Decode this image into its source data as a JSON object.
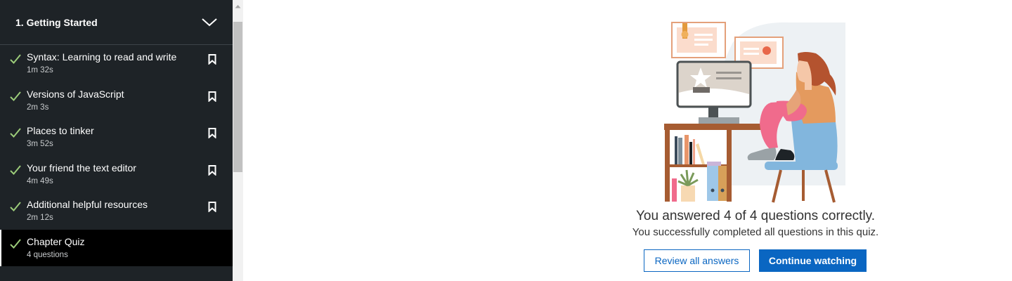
{
  "sidebar": {
    "chapter_title": "1. Getting Started",
    "items": [
      {
        "title": "Syntax: Learning to read and write",
        "duration": "1m 32s"
      },
      {
        "title": "Versions of JavaScript",
        "duration": "2m 3s"
      },
      {
        "title": "Places to tinker",
        "duration": "3m 52s"
      },
      {
        "title": "Your friend the text editor",
        "duration": "4m 49s"
      },
      {
        "title": "Additional helpful resources",
        "duration": "2m 12s"
      },
      {
        "title": "Chapter Quiz",
        "duration": "4 questions"
      }
    ]
  },
  "quiz_result": {
    "title": "You answered 4 of 4 questions correctly.",
    "subtitle": "You successfully completed all questions in this quiz."
  },
  "buttons": {
    "review_label": "Review all answers",
    "continue_label": "Continue watching"
  },
  "colors": {
    "sidebar_bg": "#1e2327",
    "check_green": "#9ccc7a",
    "primary_blue": "#0a66c2"
  },
  "icons": {
    "chapter_toggle": "chevron-down-icon",
    "completed": "check-icon",
    "bookmark": "bookmark-icon"
  }
}
